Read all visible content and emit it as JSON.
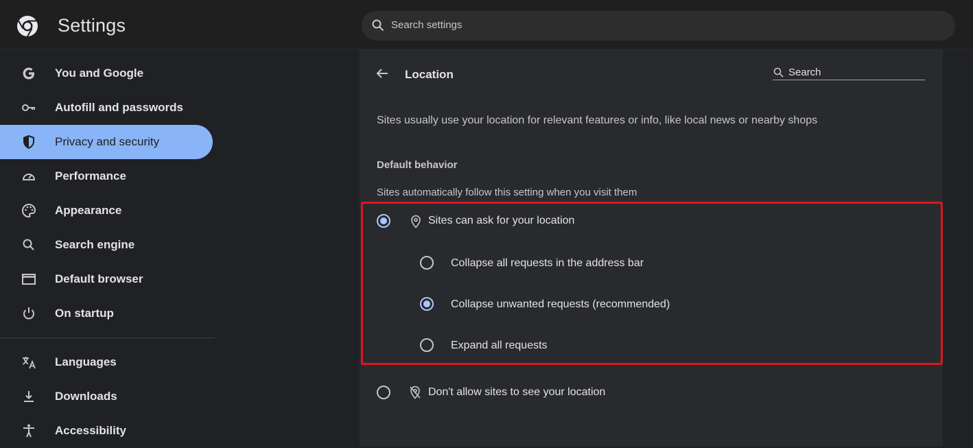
{
  "app": {
    "title": "Settings"
  },
  "search": {
    "placeholder": "Search settings"
  },
  "sidebar": {
    "items": [
      {
        "label": "You and Google",
        "icon": "google-icon"
      },
      {
        "label": "Autofill and passwords",
        "icon": "key-icon"
      },
      {
        "label": "Privacy and security",
        "icon": "shield-icon",
        "active": true
      },
      {
        "label": "Performance",
        "icon": "speedometer-icon"
      },
      {
        "label": "Appearance",
        "icon": "palette-icon"
      },
      {
        "label": "Search engine",
        "icon": "search-icon"
      },
      {
        "label": "Default browser",
        "icon": "browser-window-icon"
      },
      {
        "label": "On startup",
        "icon": "power-icon"
      },
      {
        "label": "Languages",
        "icon": "translate-icon"
      },
      {
        "label": "Downloads",
        "icon": "download-icon"
      },
      {
        "label": "Accessibility",
        "icon": "accessibility-icon"
      }
    ]
  },
  "page": {
    "title": "Location",
    "search_label": "Search",
    "description": "Sites usually use your location for relevant features or info, like local news or nearby shops",
    "default_behavior": {
      "heading": "Default behavior",
      "subheading": "Sites automatically follow this setting when you visit them",
      "options": [
        {
          "label": "Sites can ask for your location",
          "checked": true,
          "icon": "location-pin-icon"
        },
        {
          "label": "Don't allow sites to see your location",
          "checked": false,
          "icon": "location-off-icon"
        }
      ],
      "sub_options": [
        {
          "label": "Collapse all requests in the address bar",
          "checked": false
        },
        {
          "label": "Collapse unwanted requests (recommended)",
          "checked": true
        },
        {
          "label": "Expand all requests",
          "checked": false
        }
      ]
    }
  },
  "colors": {
    "accent": "#8ab4f8",
    "highlight_border": "#e0141e",
    "radio_checked": "#a8c7fa"
  }
}
